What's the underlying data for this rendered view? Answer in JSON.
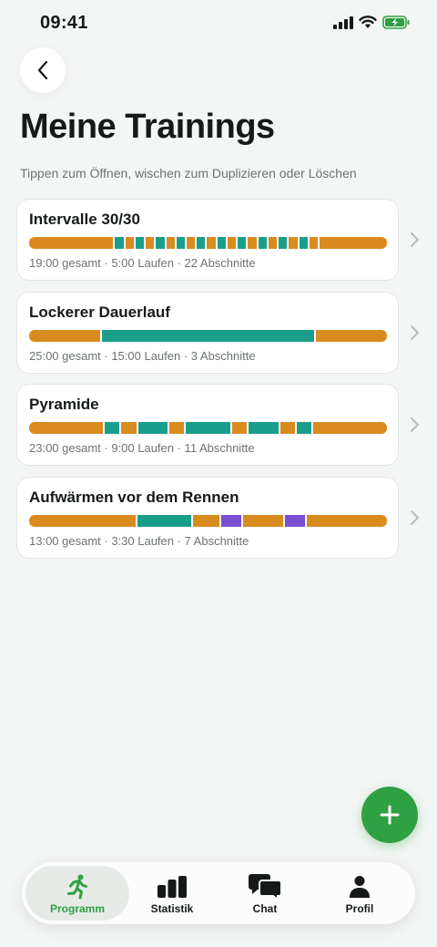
{
  "status_bar": {
    "time": "09:41"
  },
  "header": {
    "title": "Meine Trainings",
    "subtitle": "Tippen zum Öffnen, wischen zum Duplizieren oder Löschen"
  },
  "colors": {
    "warmup": "#d98b1f",
    "run": "#1a9e8c",
    "sprint": "#7a4fd0",
    "accent": "#2fa043"
  },
  "trainings": [
    {
      "title": "Intervalle 30/30",
      "meta": "19:00 gesamt · 5:00 Laufen · 22 Abschnitte",
      "segments": [
        {
          "type": "warmup",
          "minutes": 5
        },
        {
          "type": "run",
          "minutes": 0.5
        },
        {
          "type": "warmup",
          "minutes": 0.5
        },
        {
          "type": "run",
          "minutes": 0.5
        },
        {
          "type": "warmup",
          "minutes": 0.5
        },
        {
          "type": "run",
          "minutes": 0.5
        },
        {
          "type": "warmup",
          "minutes": 0.5
        },
        {
          "type": "run",
          "minutes": 0.5
        },
        {
          "type": "warmup",
          "minutes": 0.5
        },
        {
          "type": "run",
          "minutes": 0.5
        },
        {
          "type": "warmup",
          "minutes": 0.5
        },
        {
          "type": "run",
          "minutes": 0.5
        },
        {
          "type": "warmup",
          "minutes": 0.5
        },
        {
          "type": "run",
          "minutes": 0.5
        },
        {
          "type": "warmup",
          "minutes": 0.5
        },
        {
          "type": "run",
          "minutes": 0.5
        },
        {
          "type": "warmup",
          "minutes": 0.5
        },
        {
          "type": "run",
          "minutes": 0.5
        },
        {
          "type": "warmup",
          "minutes": 0.5
        },
        {
          "type": "run",
          "minutes": 0.5
        },
        {
          "type": "warmup",
          "minutes": 0.5
        },
        {
          "type": "warmup",
          "minutes": 4
        }
      ]
    },
    {
      "title": "Lockerer Dauerlauf",
      "meta": "25:00 gesamt · 15:00 Laufen · 3 Abschnitte",
      "segments": [
        {
          "type": "warmup",
          "minutes": 5
        },
        {
          "type": "run",
          "minutes": 15
        },
        {
          "type": "warmup",
          "minutes": 5
        }
      ]
    },
    {
      "title": "Pyramide",
      "meta": "23:00 gesamt · 9:00 Laufen · 11 Abschnitte",
      "segments": [
        {
          "type": "warmup",
          "minutes": 5
        },
        {
          "type": "run",
          "minutes": 1
        },
        {
          "type": "warmup",
          "minutes": 1
        },
        {
          "type": "run",
          "minutes": 2
        },
        {
          "type": "warmup",
          "minutes": 1
        },
        {
          "type": "run",
          "minutes": 3
        },
        {
          "type": "warmup",
          "minutes": 1
        },
        {
          "type": "run",
          "minutes": 2
        },
        {
          "type": "warmup",
          "minutes": 1
        },
        {
          "type": "run",
          "minutes": 1
        },
        {
          "type": "warmup",
          "minutes": 5
        }
      ]
    },
    {
      "title": "Aufwärmen vor dem Rennen",
      "meta": "13:00 gesamt · 3:30 Laufen · 7 Abschnitte",
      "segments": [
        {
          "type": "warmup",
          "minutes": 4
        },
        {
          "type": "run",
          "minutes": 2
        },
        {
          "type": "warmup",
          "minutes": 1
        },
        {
          "type": "sprint",
          "minutes": 0.75
        },
        {
          "type": "warmup",
          "minutes": 1.5
        },
        {
          "type": "sprint",
          "minutes": 0.75
        },
        {
          "type": "warmup",
          "minutes": 3
        }
      ]
    }
  ],
  "tabs": [
    {
      "label": "Programm",
      "icon": "runner-icon",
      "active": true
    },
    {
      "label": "Statistik",
      "icon": "bar-chart-icon",
      "active": false
    },
    {
      "label": "Chat",
      "icon": "chat-bubbles-icon",
      "active": false
    },
    {
      "label": "Profil",
      "icon": "person-icon",
      "active": false
    }
  ]
}
